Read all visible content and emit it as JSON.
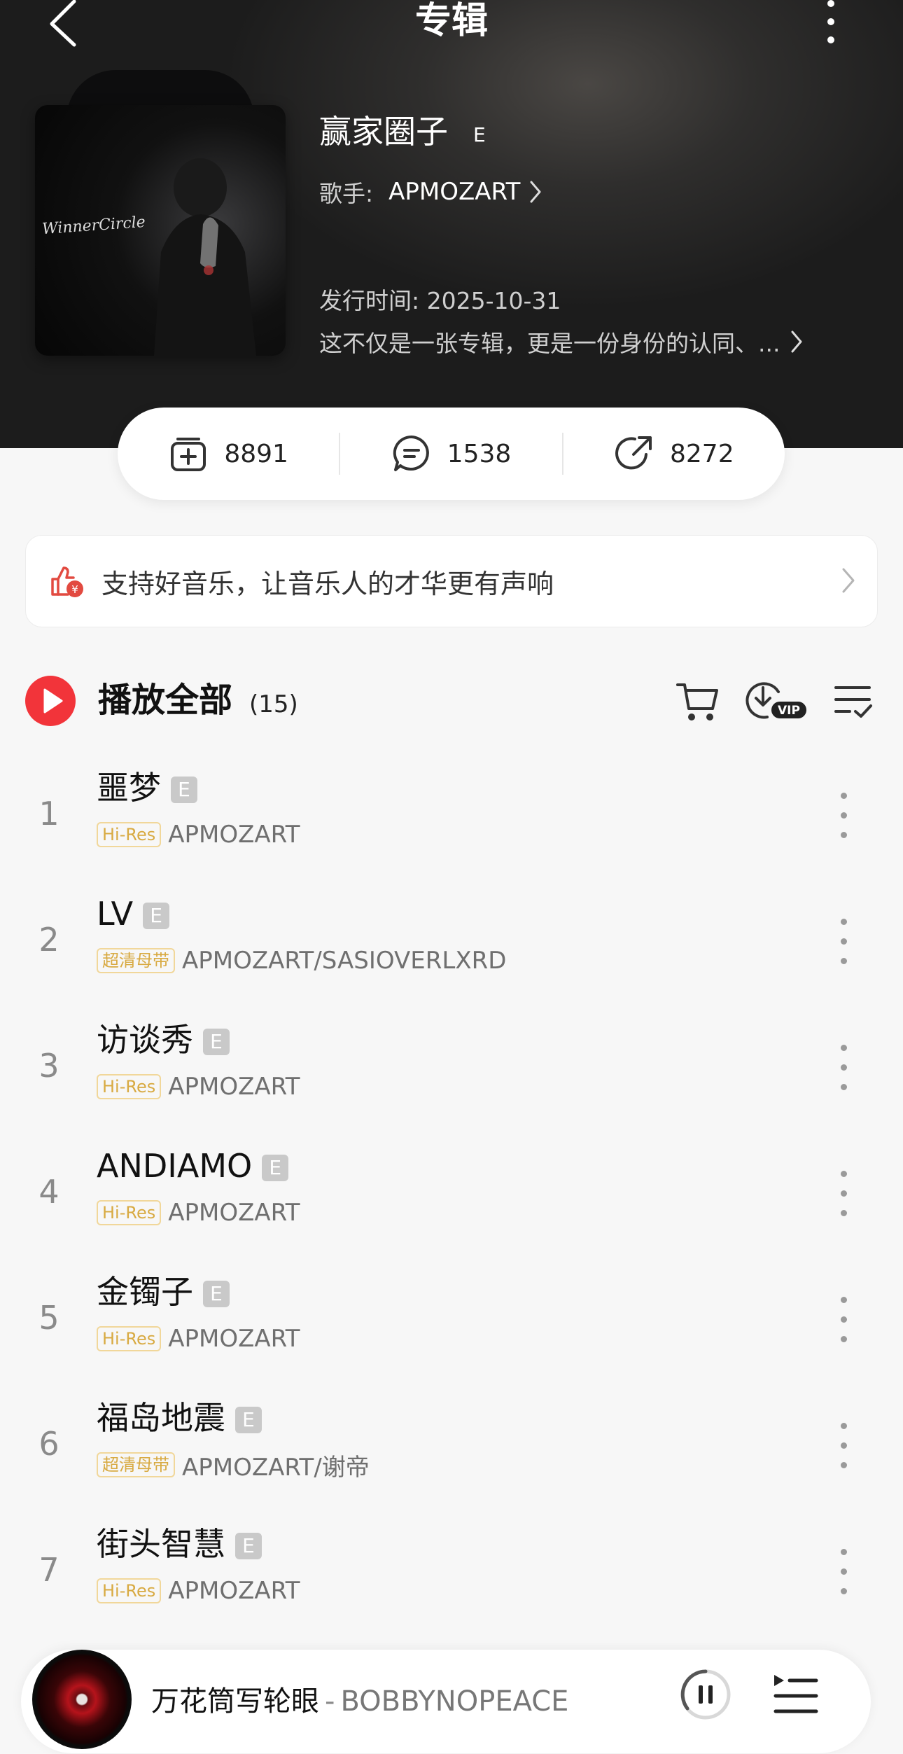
{
  "header": {
    "title": "专辑"
  },
  "album": {
    "title": "赢家圈子",
    "explicit_mark": "E",
    "cover_script_text": "WinnerCircle",
    "artist_prefix": "歌手:",
    "artist": "APMOZART",
    "release_date": "发行时间: 2025-10-31",
    "description": "这不仅是一张专辑，更是一份身份的认同、..."
  },
  "stats": {
    "collect_count": "8891",
    "comment_count": "1538",
    "share_count": "8272"
  },
  "banner": {
    "text": "支持好音乐，让音乐人的才华更有声响"
  },
  "list_header": {
    "play_all_label": "播放全部",
    "count": "(15)",
    "download_badge": "VIP"
  },
  "tracks": [
    {
      "num": "1",
      "title": "噩梦",
      "badge": "E",
      "quality": "Hi-Res",
      "artist": "APMOZART"
    },
    {
      "num": "2",
      "title": "LV",
      "badge": "E",
      "quality": "超清母带",
      "artist": "APMOZART/SASIOVERLXRD"
    },
    {
      "num": "3",
      "title": "访谈秀",
      "badge": "E",
      "quality": "Hi-Res",
      "artist": "APMOZART"
    },
    {
      "num": "4",
      "title": "ANDIAMO",
      "badge": "E",
      "quality": "Hi-Res",
      "artist": "APMOZART"
    },
    {
      "num": "5",
      "title": "金镯子",
      "badge": "E",
      "quality": "Hi-Res",
      "artist": "APMOZART"
    },
    {
      "num": "6",
      "title": "福岛地震",
      "badge": "E",
      "quality": "超清母带",
      "artist": "APMOZART/谢帝"
    },
    {
      "num": "7",
      "title": "街头智慧",
      "badge": "E",
      "quality": "Hi-Res",
      "artist": "APMOZART"
    }
  ],
  "player": {
    "song": "万花筒写轮眼",
    "separator": "-",
    "artist": "BOBBYNOPEACE"
  },
  "colors": {
    "accent_red": "#f2343a",
    "hires_gold": "#d8aa42",
    "hero_dark": "#2f2e2d"
  }
}
